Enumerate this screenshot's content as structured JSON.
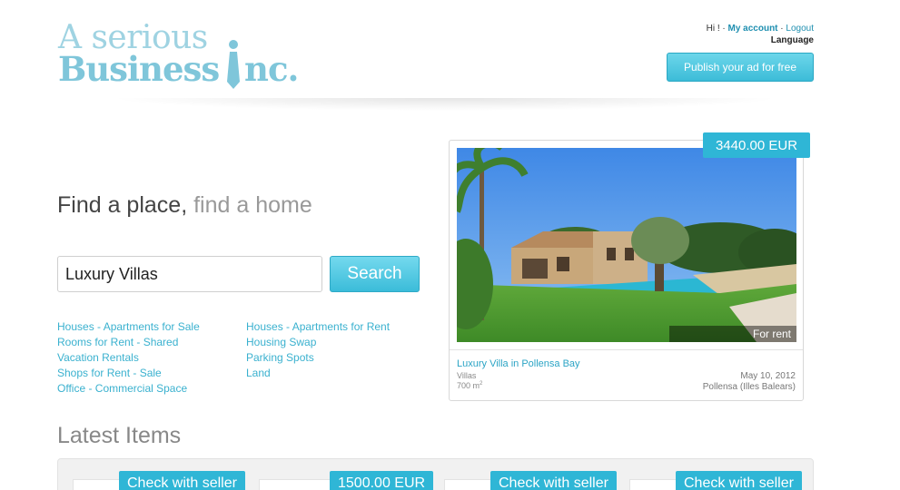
{
  "brand": {
    "logo_line1": "A serious",
    "logo_line2_start": "Business ",
    "logo_line2_end": "nc."
  },
  "user_nav": {
    "greeting": "Hi ! · ",
    "account": "My account",
    "separator": " · ",
    "logout": "Logout",
    "language": "Language"
  },
  "header": {
    "publish_label": "Publish your ad for free"
  },
  "search": {
    "tagline_main": "Find a place,",
    "tagline_muted": "find a home",
    "query": "Luxury Villas",
    "button_label": "Search"
  },
  "categories": {
    "left": [
      "Houses - Apartments for Sale",
      "Rooms for Rent - Shared",
      "Vacation Rentals",
      "Shops for Rent - Sale",
      "Office - Commercial Space"
    ],
    "right": [
      "Houses - Apartments for Rent",
      "Housing Swap",
      "Parking Spots",
      "Land"
    ]
  },
  "featured": {
    "price": "3440.00 EUR",
    "status": "For rent",
    "title": "Luxury Villa in Pollensa Bay",
    "type": "Villas",
    "area": "700 m",
    "area_sup": "2",
    "date": "May 10, 2012",
    "location": "Pollensa (Illes Balears)"
  },
  "latest": {
    "title": "Latest Items",
    "items": [
      {
        "price": "Check with seller"
      },
      {
        "price": "1500.00 EUR"
      },
      {
        "price": "Check with seller"
      },
      {
        "price": "Check with seller"
      }
    ]
  },
  "colors": {
    "accent": "#2fb6d6",
    "link": "#3ab1cf",
    "logo": "#8cc9d9"
  }
}
